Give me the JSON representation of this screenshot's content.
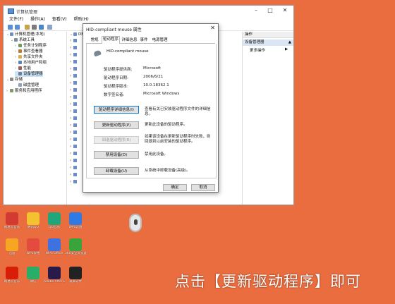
{
  "main_window": {
    "title": "计算机管理",
    "menu": [
      "文件(F)",
      "操作(A)",
      "查看(V)",
      "帮助(H)"
    ],
    "tree": [
      {
        "label": "计算机管理(本地)",
        "level": 0,
        "expanded": true
      },
      {
        "label": "系统工具",
        "level": 1,
        "expanded": true
      },
      {
        "label": "任务计划程序",
        "level": 2,
        "expanded": false
      },
      {
        "label": "事件查看器",
        "level": 2,
        "expanded": false
      },
      {
        "label": "共享文件夹",
        "level": 2,
        "expanded": false
      },
      {
        "label": "本地用户和组",
        "level": 2,
        "expanded": false
      },
      {
        "label": "性能",
        "level": 2,
        "expanded": false
      },
      {
        "label": "设备管理器",
        "level": 2,
        "selected": true
      },
      {
        "label": "存储",
        "level": 1,
        "expanded": true
      },
      {
        "label": "磁盘管理",
        "level": 2
      },
      {
        "label": "服务和应用程序",
        "level": 1,
        "expanded": false
      }
    ],
    "device_panel_first_label": "DE",
    "actions": {
      "header": "操作",
      "group": "设备管理器",
      "more": "更多操作"
    }
  },
  "dialog": {
    "title": "HID-compliant mouse 属性",
    "tabs": [
      "常规",
      "驱动程序",
      "详细信息",
      "事件",
      "电源管理"
    ],
    "active_tab": 1,
    "device_name": "HID-compliant mouse",
    "props": [
      {
        "label": "驱动程序提供商:",
        "value": "Microsoft"
      },
      {
        "label": "驱动程序日期:",
        "value": "2006/6/21"
      },
      {
        "label": "驱动程序版本:",
        "value": "10.0.18362.1"
      },
      {
        "label": "数字签名者:",
        "value": "Microsoft Windows"
      }
    ],
    "buttons": [
      {
        "label": "驱动程序详细信息(I)",
        "desc": "查看有关已安装驱动程序文件的详细信息。"
      },
      {
        "label": "更新驱动程序(P)",
        "desc": "更新此设备的驱动程序。"
      },
      {
        "label": "回退驱动程序(R)",
        "desc": "如果该设备在更新驱动程序时失败，则回退到以前安装的驱动程序。",
        "disabled": true
      },
      {
        "label": "禁用设备(D)",
        "desc": "禁用此设备。"
      },
      {
        "label": "卸载设备(U)",
        "desc": "从系统中卸载设备(高级)。"
      }
    ],
    "ok": "确定",
    "cancel": "取消"
  },
  "desktop_icons": [
    {
      "label": "网易云音乐",
      "color": "#d33a31"
    },
    {
      "label": "腾讯QQ",
      "color": "#f2c230"
    },
    {
      "label": "QQ音乐",
      "color": "#1fa67a"
    },
    {
      "label": "WPS云盘",
      "color": "#2f7ae5"
    },
    {
      "label": "迅雷",
      "color": "#f6a623"
    },
    {
      "label": "WPS表格",
      "color": "#e24b3d"
    },
    {
      "label": "WPS Office",
      "color": "#3d72e0"
    },
    {
      "label": "360安全浏览器",
      "color": "#3aa43c"
    },
    {
      "label": "网易云音乐",
      "color": "#d81e06"
    },
    {
      "label": "微信",
      "color": "#2aae67"
    },
    {
      "label": "Adobe After Effects 2020",
      "color": "#2a1a4a"
    },
    {
      "label": "录屏软件",
      "color": "#222222"
    }
  ],
  "caption": "点击【更新驱动程序】即可",
  "colors": {
    "desktop": "#ea6d40",
    "selection": "#cce4f7",
    "accent": "#0078d7"
  }
}
